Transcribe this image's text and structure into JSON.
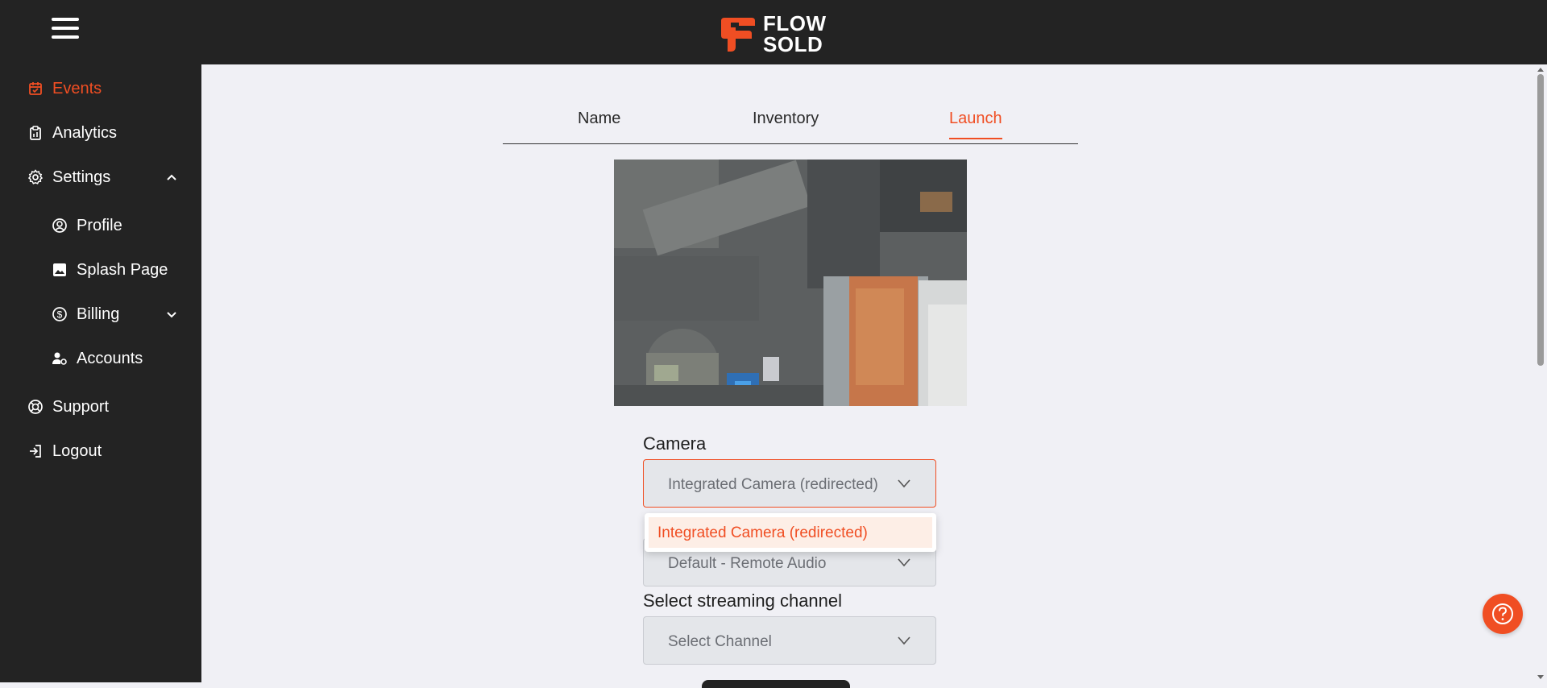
{
  "app": {
    "logo_line1": "FLOW",
    "logo_line2": "SOLD",
    "accent_color": "#f04e23"
  },
  "sidebar": {
    "items": [
      {
        "label": "Events",
        "icon": "calendar-icon",
        "active": true
      },
      {
        "label": "Analytics",
        "icon": "clipboard-chart-icon"
      },
      {
        "label": "Settings",
        "icon": "gear-icon",
        "expanded": true
      },
      {
        "label": "Profile",
        "icon": "user-circle-icon"
      },
      {
        "label": "Splash Page",
        "icon": "image-icon"
      },
      {
        "label": "Billing",
        "icon": "dollar-circle-icon"
      },
      {
        "label": "Accounts",
        "icon": "user-gear-icon"
      },
      {
        "label": "Support",
        "icon": "lifebuoy-icon"
      },
      {
        "label": "Logout",
        "icon": "logout-icon"
      }
    ]
  },
  "tabs": [
    {
      "label": "Name"
    },
    {
      "label": "Inventory"
    },
    {
      "label": "Launch",
      "active": true
    }
  ],
  "form": {
    "camera_label": "Camera",
    "camera_value": "Integrated Camera (redirected)",
    "camera_options": [
      "Integrated Camera (redirected)"
    ],
    "audio_value": "Default - Remote Audio",
    "channel_label": "Select streaming channel",
    "channel_placeholder": "Select Channel"
  },
  "help": {
    "icon": "help-circle-icon"
  }
}
